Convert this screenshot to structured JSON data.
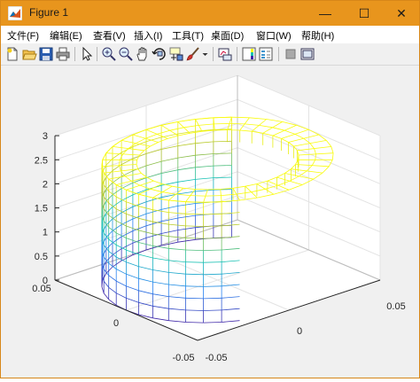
{
  "window": {
    "title": "Figure 1",
    "min_glyph": "—",
    "max_glyph": "☐",
    "close_glyph": "✕"
  },
  "menu": [
    "文件(F)",
    "编辑(E)",
    "查看(V)",
    "插入(I)",
    "工具(T)",
    "桌面(D)",
    "窗口(W)",
    "帮助(H)"
  ],
  "toolbar": {
    "icons": [
      "new-figure-icon",
      "open-file-icon",
      "save-icon",
      "print-icon",
      "edit-plot-arrow-icon",
      "zoom-in-icon",
      "zoom-out-icon",
      "pan-hand-icon",
      "rotate-3d-icon",
      "data-cursor-icon",
      "brush-icon",
      "link-plot-icon",
      "insert-colorbar-icon",
      "insert-legend-icon",
      "hide-plot-tools-icon",
      "show-plot-tools-icon"
    ]
  },
  "chart_data": {
    "type": "surface-mesh",
    "description_shape": "cylindrical shell (annular ring top) rendered as 3-D mesh",
    "z_ticks": [
      "0",
      "0.5",
      "1",
      "1.5",
      "2",
      "2.5",
      "3"
    ],
    "x_ticks": [
      "-0.05",
      "0",
      "0.05"
    ],
    "y_ticks": [
      "-0.05",
      "0",
      "0.05"
    ],
    "xlim": [
      -0.05,
      0.05
    ],
    "ylim": [
      -0.05,
      0.05
    ],
    "zlim": [
      0,
      3
    ],
    "grid": true,
    "colormap": "parula",
    "colors": {
      "low": "#3e26a8",
      "mid": "#16c0b3",
      "high": "#f9fb0e"
    }
  }
}
